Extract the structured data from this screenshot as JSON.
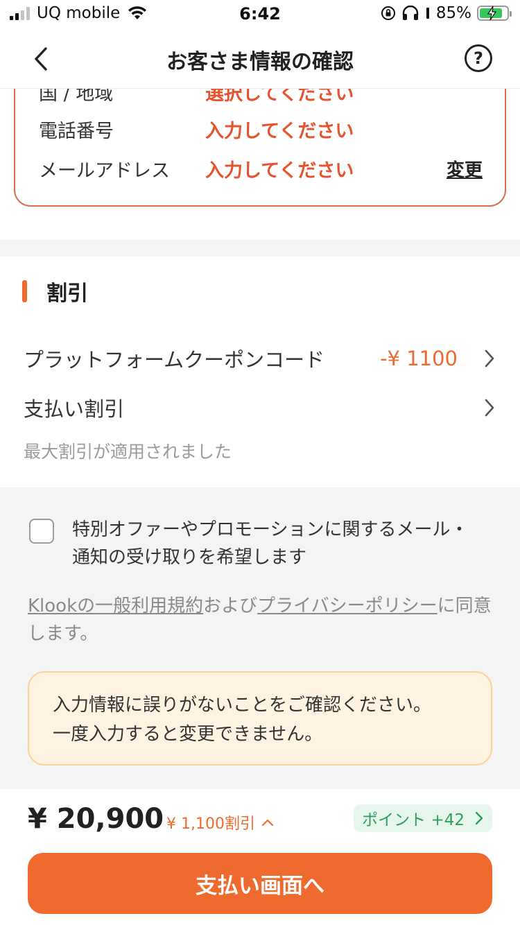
{
  "status_bar": {
    "carrier": "UQ mobile",
    "time": "6:42",
    "battery_percent": "85%",
    "battery_level": 0.85
  },
  "nav": {
    "title": "お客さま情報の確認",
    "back_icon": "chevron-left-icon",
    "help_icon": "question-circle-icon",
    "help_glyph": "?"
  },
  "contact": {
    "rows": [
      {
        "label": "国 / 地域",
        "value": "選択してください"
      },
      {
        "label": "電話番号",
        "value": "入力してください"
      },
      {
        "label": "メールアドレス",
        "value": "入力してください"
      }
    ],
    "change_label": "変更"
  },
  "discount": {
    "title": "割引",
    "coupon_label": "プラットフォームクーポンコード",
    "coupon_amount": "-¥ 1100",
    "payment_label": "支払い割引",
    "note": "最大割引が適用されました"
  },
  "consent": {
    "optin_text": "特別オファーやプロモーションに関するメール・通知の受け取りを希望します",
    "terms_link_1": "Klookの一般利用規約",
    "terms_mid": "および",
    "terms_link_2": "プライバシーポリシー",
    "terms_end": "に同意します。"
  },
  "notice": {
    "line1": "入力情報に誤りがないことをご確認ください。",
    "line2": "一度入力すると変更できません。"
  },
  "footer": {
    "total": "¥ 20,900",
    "discount_text": "¥ 1,100割引",
    "points_text": "ポイント  +42",
    "pay_button": "支払い画面へ"
  },
  "colors": {
    "accent": "#ee6a2f",
    "warning_text": "#e6542f",
    "points_green": "#2f9e5b",
    "notice_bg": "#fdf3e0"
  }
}
